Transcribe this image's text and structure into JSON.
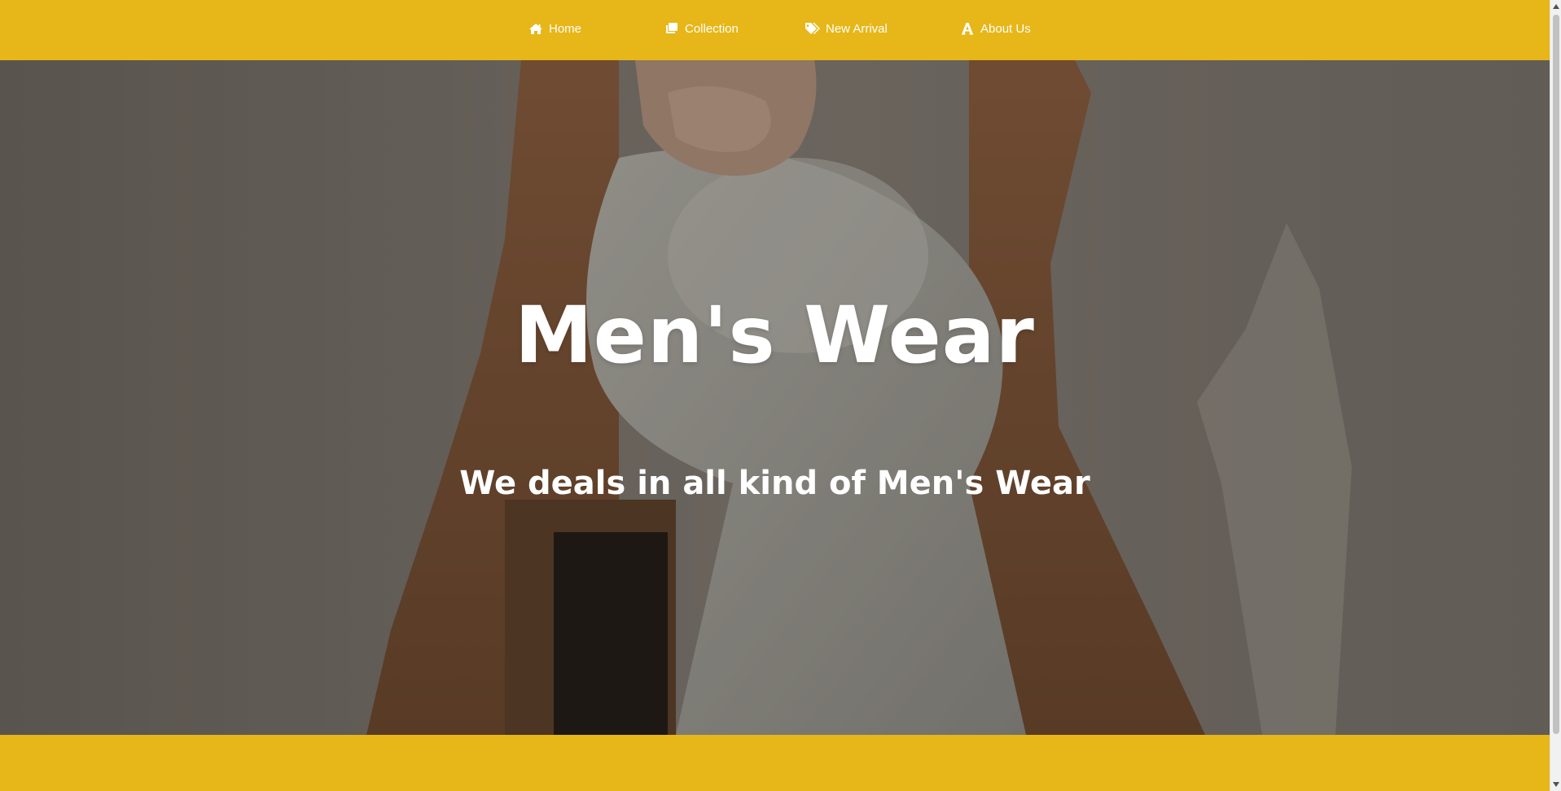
{
  "nav": {
    "items": [
      {
        "label": "Home",
        "icon": "home-icon"
      },
      {
        "label": "Collection",
        "icon": "collection-icon"
      },
      {
        "label": "New Arrival",
        "icon": "tags-icon"
      },
      {
        "label": "About Us",
        "icon": "font-a-icon"
      }
    ]
  },
  "hero": {
    "title": "Men's Wear",
    "subtitle": "We deals in all kind of Men's Wear",
    "background_image": "man-in-brown-coat-and-white-pants-sitting-photo"
  },
  "colors": {
    "accent": "#e7b618",
    "text_on_accent": "#ffffff",
    "hero_text": "#ffffff"
  }
}
